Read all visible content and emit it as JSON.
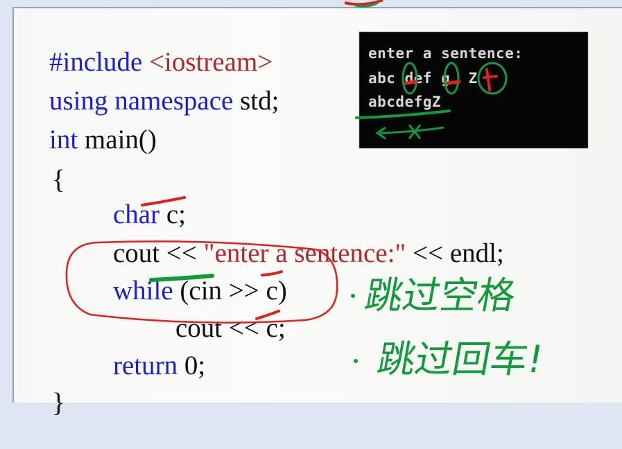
{
  "code": {
    "line1": {
      "keyword": "#include",
      "header": "<iostream>"
    },
    "line2": {
      "keyword": "using namespace",
      "rest": "std;"
    },
    "line3": {
      "keyword": "int",
      "rest": "main()"
    },
    "line4": {
      "brace": "{"
    },
    "line5": {
      "keyword": "char",
      "rest": "c;"
    },
    "line6": {
      "start": "cout",
      "op": " << ",
      "string": "\"enter a sentence:\"",
      "end": " << endl;"
    },
    "line7": {
      "keyword": "while",
      "rest": "(cin >> c)"
    },
    "line8": {
      "text": "cout << c;"
    },
    "line9": {
      "keyword": "return",
      "rest": "0;"
    },
    "line10": {
      "brace": "}"
    }
  },
  "console": {
    "line1": "enter a sentence:",
    "line2": "abc def g  Z",
    "line3": "abcdefgZ"
  },
  "annotations": {
    "note1": "跳过空格",
    "note2": "跳过回车!"
  },
  "colors": {
    "keyword": "#1d1ecf",
    "string": "#b3262b",
    "annotation_red": "#e02020",
    "annotation_green": "#139a3c"
  }
}
